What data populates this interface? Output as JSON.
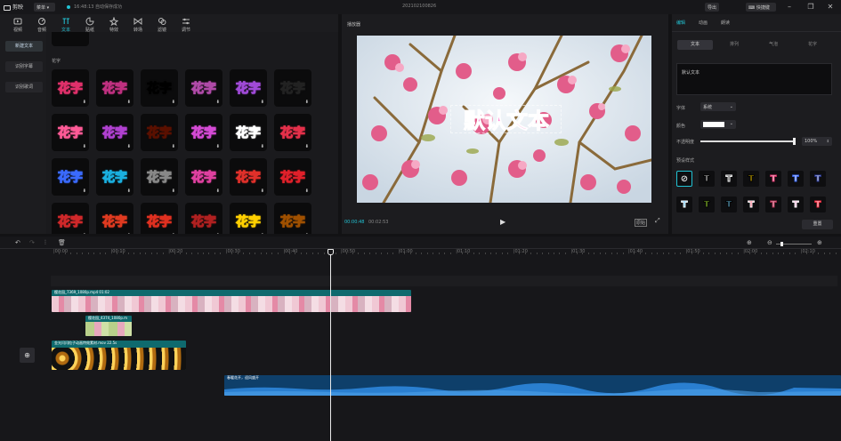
{
  "titlebar": {
    "app_name": "剪映",
    "menu_label": "菜单",
    "save_status": "16:48:13 自动保存成功",
    "doc_title": "202102100826",
    "export_label": "导出",
    "shortcut_label": "快捷键",
    "colors": {
      "accent": "#22c3d4"
    }
  },
  "toolbar": {
    "items": [
      {
        "label": "视频",
        "icon": "video-icon"
      },
      {
        "label": "音频",
        "icon": "audio-icon"
      },
      {
        "label": "文本",
        "icon": "text-icon",
        "active": true
      },
      {
        "label": "贴纸",
        "icon": "sticker-icon"
      },
      {
        "label": "特效",
        "icon": "effects-icon"
      },
      {
        "label": "转场",
        "icon": "transition-icon"
      },
      {
        "label": "滤镜",
        "icon": "filter-icon"
      },
      {
        "label": "调节",
        "icon": "adjust-icon"
      }
    ]
  },
  "text_sidebar": {
    "items": [
      {
        "label": "新建文本",
        "active": true
      },
      {
        "label": "识别字幕"
      },
      {
        "label": "识别歌词"
      }
    ]
  },
  "effects_grid": {
    "section_label": "花字",
    "sample_text": "花字",
    "download_glyph": "⬇",
    "cells": [
      {
        "fill": "#fff",
        "stroke": "#e0306a"
      },
      {
        "fill": "#ffd1e8",
        "stroke": "#c03080"
      },
      {
        "fill": "#d61c2e",
        "stroke": "#000"
      },
      {
        "fill": "#f6d5f5",
        "stroke": "#b04aa8"
      },
      {
        "fill": "#fff",
        "stroke": "#a04ad8"
      },
      {
        "fill": "#fff",
        "stroke": "#222"
      },
      {
        "fill": "#fff",
        "stroke": "#ff5a96"
      },
      {
        "fill": "#fbe2ff",
        "stroke": "#b040d0"
      },
      {
        "fill": "#ff6a3a",
        "stroke": "#5a1000"
      },
      {
        "fill": "#fff",
        "stroke": "#d44ad4"
      },
      {
        "fill": "#e81c24",
        "stroke": "#fff"
      },
      {
        "fill": "#fff",
        "stroke": "#e4304a"
      },
      {
        "fill": "#fff",
        "stroke": "#3a6aff"
      },
      {
        "fill": "#bff5ff",
        "stroke": "#1ab0e0"
      },
      {
        "fill": "#fff",
        "stroke": "#888"
      },
      {
        "fill": "#ffe4f0",
        "stroke": "#e040a0"
      },
      {
        "fill": "#ffe070",
        "stroke": "#e0302a"
      },
      {
        "fill": "#fff",
        "stroke": "#e0202a"
      },
      {
        "fill": "#fff",
        "stroke": "#d0282a"
      },
      {
        "fill": "#ffd09a",
        "stroke": "#e03a20"
      },
      {
        "fill": "#ffd000",
        "stroke": "#e03020"
      },
      {
        "fill": "#ffe040",
        "stroke": "#b02020"
      },
      {
        "fill": "#ff2a20",
        "stroke": "#ffd000"
      },
      {
        "fill": "#ffd23a",
        "stroke": "#a05000"
      }
    ]
  },
  "player": {
    "title": "播放器",
    "overlay_text": "默认文本",
    "current_time": "00:00:48",
    "total_time": "00:02:53",
    "ratio_label": "原始"
  },
  "inspector": {
    "tabs": [
      {
        "label": "编辑",
        "active": true
      },
      {
        "label": "动画"
      },
      {
        "label": "朗读"
      }
    ],
    "subtabs": [
      {
        "label": "文本",
        "active": true
      },
      {
        "label": "排列"
      },
      {
        "label": "气泡"
      },
      {
        "label": "花字"
      }
    ],
    "text_value": "默认文本",
    "font_label": "字体",
    "font_value": "系统",
    "color_label": "颜色",
    "opacity_label": "不透明度",
    "opacity_value": "100%",
    "opacity_fraction": 1.0,
    "preset_label": "预设样式",
    "reset_label": "重置",
    "presets_row1": [
      {
        "type": "none"
      },
      {
        "glyph": "T",
        "fill": "#fff",
        "stroke": "#000"
      },
      {
        "glyph": "T",
        "fill": "#111",
        "stroke": "#fff"
      },
      {
        "glyph": "T",
        "fill": "#ffd400",
        "stroke": "#000"
      },
      {
        "glyph": "T",
        "fill": "#fff",
        "stroke": "#e0306a"
      },
      {
        "glyph": "T",
        "fill": "#fff",
        "stroke": "#3a6aff"
      },
      {
        "glyph": "T",
        "fill": "#fff",
        "stroke": "#2a3a9a"
      }
    ],
    "presets_row2": [
      {
        "glyph": "T",
        "fill": "#3ab0ff",
        "stroke": "#fff"
      },
      {
        "glyph": "T",
        "fill": "#b8ff3a",
        "stroke": "#000"
      },
      {
        "glyph": "T",
        "fill": "#7ad8ff",
        "stroke": "#000"
      },
      {
        "glyph": "T",
        "fill": "#ff4a6a",
        "stroke": "#fff"
      },
      {
        "glyph": "T",
        "fill": "#ffd0e0",
        "stroke": "#b03050"
      },
      {
        "glyph": "T",
        "fill": "#ff9ad0",
        "stroke": "#fff"
      },
      {
        "glyph": "T",
        "fill": "#ffffff",
        "stroke": "#ff2a40"
      }
    ]
  },
  "timeline": {
    "ticks": [
      "00:00",
      "00:10",
      "00:20",
      "00:30",
      "00:40",
      "00:50",
      "01:00",
      "01:10",
      "01:20",
      "01:30",
      "01:40",
      "01:50",
      "02:00",
      "02:10"
    ],
    "text_clip_label": "默认文本",
    "video_clip_label": "樱花园_7369_1080p.mp4  01:02",
    "overlay_clip_label": "樱花园_4374_1080p.m",
    "effect_clip_label": "金光闪闪粒子动画特效素材.mov  22.5s",
    "audio_clip_label": "春暖花开，迎风盛开",
    "playhead_time": 48
  }
}
